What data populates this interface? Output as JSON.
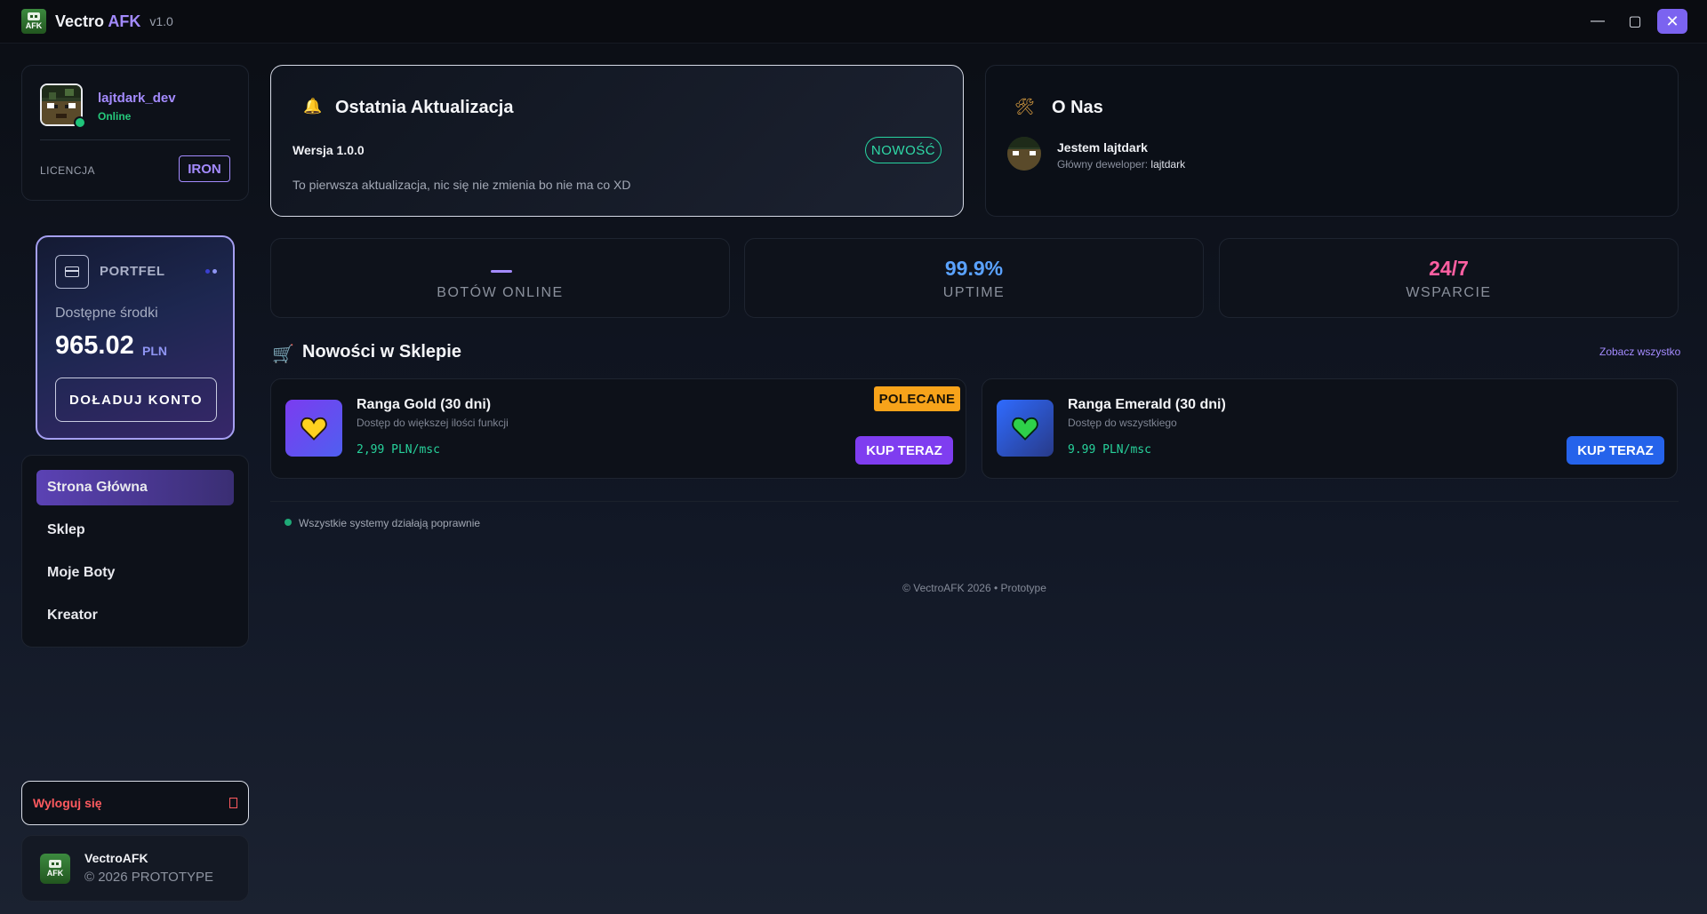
{
  "app": {
    "name_main": "Vectro",
    "name_accent": "AFK",
    "version": "v1.0",
    "logo_text": "AFK"
  },
  "window_controls": {
    "minimize": "—",
    "maximize": "▢",
    "close": "✕"
  },
  "user": {
    "name": "lajtdark_dev",
    "status": "Online",
    "license_label": "LICENCJA",
    "license_tier": "IRON"
  },
  "wallet": {
    "title": "PORTFEL",
    "available_label": "Dostępne środki",
    "amount": "965.02",
    "currency": "PLN",
    "topup_label": "DOŁADUJ KONTO"
  },
  "nav": {
    "items": [
      {
        "label": "Strona Główna",
        "active": true
      },
      {
        "label": "Sklep",
        "active": false
      },
      {
        "label": "Moje Boty",
        "active": false
      },
      {
        "label": "Kreator",
        "active": false
      }
    ]
  },
  "logout": {
    "label": "Wyloguj się"
  },
  "brand": {
    "name": "VectroAFK",
    "copyright": "© 2026 PROTOTYPE"
  },
  "update": {
    "title": "Ostatnia Aktualizacja",
    "version": "Wersja 1.0.0",
    "badge": "NOWOŚĆ",
    "text": "To pierwsza aktualizacja, nic się nie zmienia bo nie ma co XD"
  },
  "about": {
    "title": "O Nas",
    "dev_intro": "Jestem lajtdark",
    "dev_role_label": "Główny deweloper:",
    "dev_role_name": "lajtdark"
  },
  "stats": [
    {
      "value": "—",
      "label": "BOTÓW ONLINE",
      "color": "#a48bff"
    },
    {
      "value": "99.9%",
      "label": "UPTIME",
      "color": "#5aa2ff"
    },
    {
      "value": "24/7",
      "label": "WSPARCIE",
      "color": "#ff5fa2"
    }
  ],
  "shop": {
    "title": "Nowości w Sklepie",
    "see_all": "Zobacz wszystko",
    "products": [
      {
        "name": "Ranga Gold (30 dni)",
        "desc": "Dostęp do większej ilości funkcji",
        "price": "2,99 PLN/msc",
        "buy": "KUP TERAZ",
        "badge": "POLECANE",
        "icon": "heart-yellow-icon"
      },
      {
        "name": "Ranga Emerald (30 dni)",
        "desc": "Dostęp do wszystkiego",
        "price": "9.99 PLN/msc",
        "buy": "KUP TERAZ",
        "icon": "heart-green-icon"
      }
    ]
  },
  "system": {
    "status": "Wszystkie systemy działają poprawnie"
  },
  "footer": {
    "copyright": "© VectroAFK 2026 • Prototype"
  },
  "colors": {
    "accent": "#a48bff",
    "online": "#1fc47a",
    "danger": "#ff5a5f",
    "price": "#27d29b",
    "gold_button": "#7f3df0",
    "emerald_button": "#2563eb",
    "badge_featured": "#f7a31a"
  }
}
